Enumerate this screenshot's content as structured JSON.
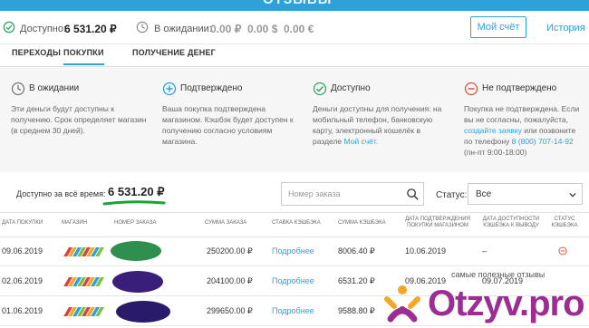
{
  "topbar": {
    "title": "ОТЗЫВЫ"
  },
  "balance": {
    "available_label": "Доступно:",
    "available_value": "6 531.20 ₽",
    "pending_label": "В ожидании:",
    "pending_rub": "0.00 ₽",
    "pending_usd": "0.00 $",
    "pending_eur": "0.00 €",
    "account_button": "Мой счёт",
    "history_link": "История"
  },
  "tabs": [
    {
      "label": "ПЕРЕХОДЫ"
    },
    {
      "label": "ПОКУПКИ"
    },
    {
      "label": "ПОЛУЧЕНИЕ ДЕНЕГ"
    }
  ],
  "info": {
    "pending": {
      "title": "В ожидании",
      "text": "Эти деньги будут доступны к получению. Срок определяет магазин (в среднем 30 дней)."
    },
    "confirmed": {
      "title": "Подтверждено",
      "text": "Ваша покупка подтверждена магазином. Кэшбэк будет доступен к получению согласно условиям магазина."
    },
    "available": {
      "title": "Доступно",
      "text": "Деньги доступны для получения: на мобильный телефон, банковскую карту, электронный кошелёк в разделе",
      "link": "Мой счёт."
    },
    "rejected": {
      "title": "Не подтверждено",
      "text": "Покупка не подтверждена. Если вы не согласны, пожалуйста,",
      "link": "создайте заявку",
      "text2": "или позвоните по телефону",
      "phone": "8 (800) 707-14-92",
      "hours": "(пн-пт 9:00-18:00)"
    }
  },
  "summary": {
    "label": "Доступно за всё время:",
    "value": "6 531.20 ₽",
    "search_placeholder": "Номер заказа",
    "status_label": "Статус:",
    "status_value": "Все"
  },
  "table": {
    "headers": [
      "ДАТА ПОКУПКИ",
      "МАГАЗИН",
      "НОМЕР ЗАКАЗА",
      "СУММА ЗАКАЗА",
      "СТАВКА КЭШБЭКА",
      "СУММА КЭШБЭКА",
      "ДАТА ПОДТВЕРЖДЕНИЯ ПОКУПКИ МАГАЗИНОМ",
      "ДАТА ДОСТУПНОСТИ КЭШБЭКА К ВЫВОДУ",
      "СТАТУС КЭШБЭКА"
    ],
    "rows": [
      {
        "date": "09.06.2019",
        "amount": "250200.00 ₽",
        "rate": "Подробнее",
        "cashback": "8006.40 ₽",
        "confirm": "10.06.2019",
        "avail": "–"
      },
      {
        "date": "02.06.2019",
        "amount": "204100.00 ₽",
        "rate": "Подробнее",
        "cashback": "6531.20 ₽",
        "confirm": "09.06.2019",
        "avail": "09.07.2019"
      },
      {
        "date": "01.06.2019",
        "amount": "299650.00 ₽",
        "rate": "Подробнее",
        "cashback": "9588.80 ₽",
        "confirm": "",
        "avail": ""
      }
    ]
  },
  "watermark": {
    "caption": "самые полезные отзывы",
    "brand": "Otzyv.pro"
  },
  "colors": {
    "accent": "#2ea2d8",
    "green": "#3aa56a",
    "red": "#e0533a",
    "brand": "#9b2d93"
  }
}
